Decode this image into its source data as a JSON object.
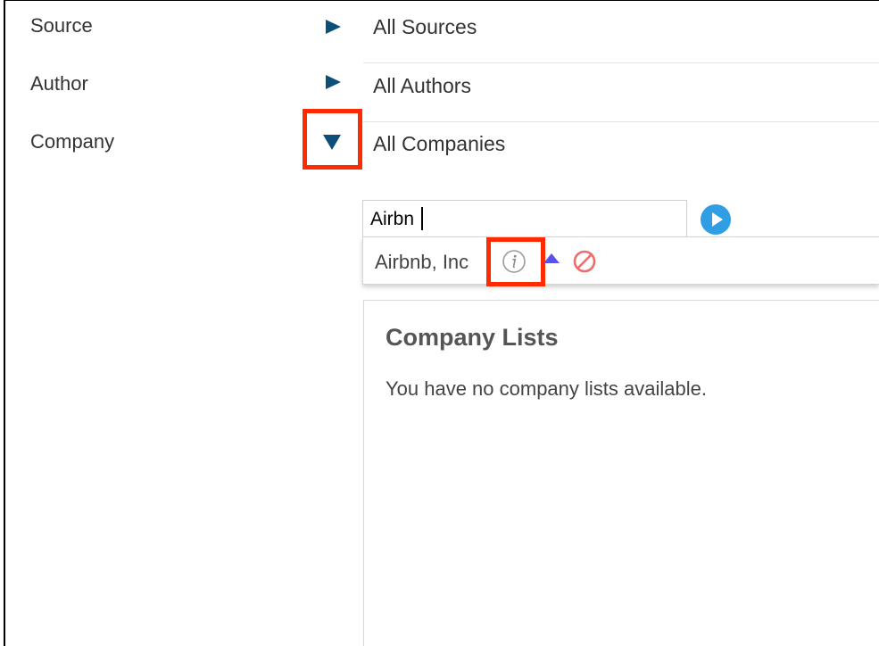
{
  "filters": [
    {
      "label": "Source",
      "value": "All Sources",
      "expanded": false
    },
    {
      "label": "Author",
      "value": "All Authors",
      "expanded": false
    },
    {
      "label": "Company",
      "value": "All Companies",
      "expanded": true
    }
  ],
  "company_search": {
    "value": "Airbn",
    "go_icon": "play-circle-icon"
  },
  "suggestion": {
    "name": "Airbnb, Inc",
    "icons": [
      "info-icon",
      "include-up-icon",
      "exclude-icon"
    ]
  },
  "company_lists": {
    "title": "Company Lists",
    "empty_message": "You have no company lists available."
  },
  "colors": {
    "arrow": "#0d4f79",
    "highlight": "#ff2a00",
    "go_button": "#2f9ee5",
    "include_icon": "#5a52e8",
    "exclude_icon": "#f06c6c"
  }
}
